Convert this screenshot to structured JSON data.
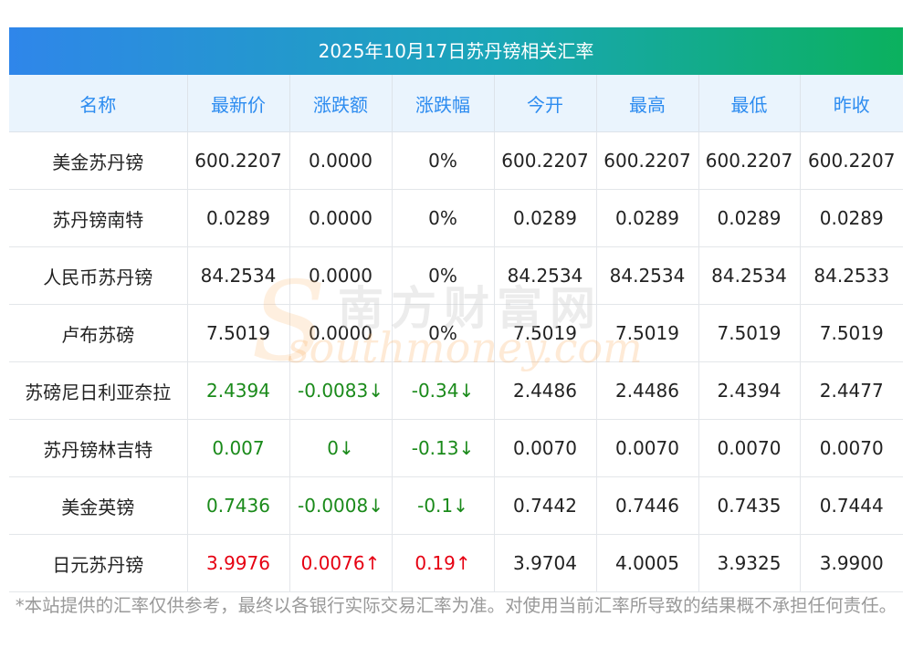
{
  "title": "2025年10月17日苏丹镑相关汇率",
  "headers": [
    "名称",
    "最新价",
    "涨跌额",
    "涨跌幅",
    "今开",
    "最高",
    "最低",
    "昨收"
  ],
  "rows": [
    {
      "name": "美金苏丹镑",
      "last": "600.2207",
      "change": "0.0000",
      "pct": "0%",
      "open": "600.2207",
      "high": "600.2207",
      "low": "600.2207",
      "prev": "600.2207",
      "trend": "flat"
    },
    {
      "name": "苏丹镑南特",
      "last": "0.0289",
      "change": "0.0000",
      "pct": "0%",
      "open": "0.0289",
      "high": "0.0289",
      "low": "0.0289",
      "prev": "0.0289",
      "trend": "flat"
    },
    {
      "name": "人民币苏丹镑",
      "last": "84.2534",
      "change": "0.0000",
      "pct": "0%",
      "open": "84.2534",
      "high": "84.2534",
      "low": "84.2534",
      "prev": "84.2533",
      "trend": "flat"
    },
    {
      "name": "卢布苏磅",
      "last": "7.5019",
      "change": "0.0000",
      "pct": "0%",
      "open": "7.5019",
      "high": "7.5019",
      "low": "7.5019",
      "prev": "7.5019",
      "trend": "flat"
    },
    {
      "name": "苏磅尼日利亚奈拉",
      "last": "2.4394",
      "change": "-0.0083↓",
      "pct": "-0.34↓",
      "open": "2.4486",
      "high": "2.4486",
      "low": "2.4394",
      "prev": "2.4477",
      "trend": "down"
    },
    {
      "name": "苏丹镑林吉特",
      "last": "0.007",
      "change": "0↓",
      "pct": "-0.13↓",
      "open": "0.0070",
      "high": "0.0070",
      "low": "0.0070",
      "prev": "0.0070",
      "trend": "down"
    },
    {
      "name": "美金英镑",
      "last": "0.7436",
      "change": "-0.0008↓",
      "pct": "-0.1↓",
      "open": "0.7442",
      "high": "0.7446",
      "low": "0.7435",
      "prev": "0.7444",
      "trend": "down"
    },
    {
      "name": "日元苏丹镑",
      "last": "3.9976",
      "change": "0.0076↑",
      "pct": "0.19↑",
      "open": "3.9704",
      "high": "4.0005",
      "low": "3.9325",
      "prev": "3.9900",
      "trend": "up"
    }
  ],
  "footnote": "*本站提供的汇率仅供参考，最终以各银行实际交易汇率为准。对使用当前汇率所导致的结果概不承担任何责任。",
  "watermark": {
    "cn": "南方财富网",
    "en": "southmoney.com"
  },
  "colors": {
    "up": "#e60012",
    "down": "#1a8a1a",
    "header_text": "#2d8cf0",
    "header_bg": "#eaf4fd"
  }
}
